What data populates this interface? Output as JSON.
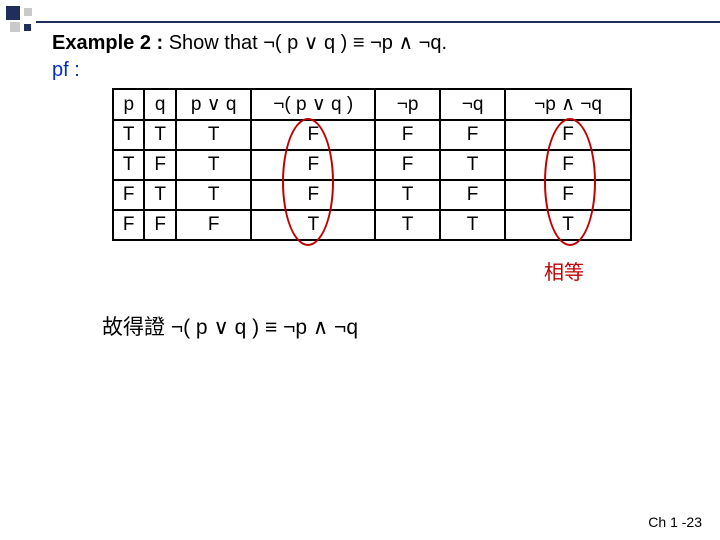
{
  "title": {
    "lead": "Example 2 : ",
    "rest_a": "Show that ",
    "expr": "¬( p ∨ q ) ≡ ¬p ∧ ¬q."
  },
  "pf_label": "pf :",
  "headers": {
    "p": "p",
    "q": "q",
    "pvq": "p ∨ q",
    "npvq": "¬( p ∨ q )",
    "np": "¬p",
    "nq": "¬q",
    "npnq": "¬p ∧ ¬q"
  },
  "rows": [
    {
      "p": "T",
      "q": "T",
      "pvq": "T",
      "npvq": "F",
      "np": "F",
      "nq": "F",
      "npnq": "F"
    },
    {
      "p": "T",
      "q": "F",
      "pvq": "T",
      "npvq": "F",
      "np": "F",
      "nq": "T",
      "npnq": "F"
    },
    {
      "p": "F",
      "q": "T",
      "pvq": "T",
      "npvq": "F",
      "np": "T",
      "nq": "F",
      "npnq": "F"
    },
    {
      "p": "F",
      "q": "F",
      "pvq": "F",
      "npvq": "T",
      "np": "T",
      "nq": "T",
      "npnq": "T"
    }
  ],
  "equal_label": "相等",
  "conclusion": "故得證 ¬( p ∨ q ) ≡ ¬p ∧ ¬q",
  "footer": "Ch 1 -23",
  "chart_data": {
    "type": "table",
    "title": "Truth table proving ¬(p∨q) ≡ ¬p∧¬q",
    "columns": [
      "p",
      "q",
      "p∨q",
      "¬(p∨q)",
      "¬p",
      "¬q",
      "¬p∧¬q"
    ],
    "rows": [
      [
        "T",
        "T",
        "T",
        "F",
        "F",
        "F",
        "F"
      ],
      [
        "T",
        "F",
        "T",
        "F",
        "F",
        "T",
        "F"
      ],
      [
        "F",
        "T",
        "T",
        "F",
        "T",
        "F",
        "F"
      ],
      [
        "F",
        "F",
        "F",
        "T",
        "T",
        "T",
        "T"
      ]
    ]
  }
}
